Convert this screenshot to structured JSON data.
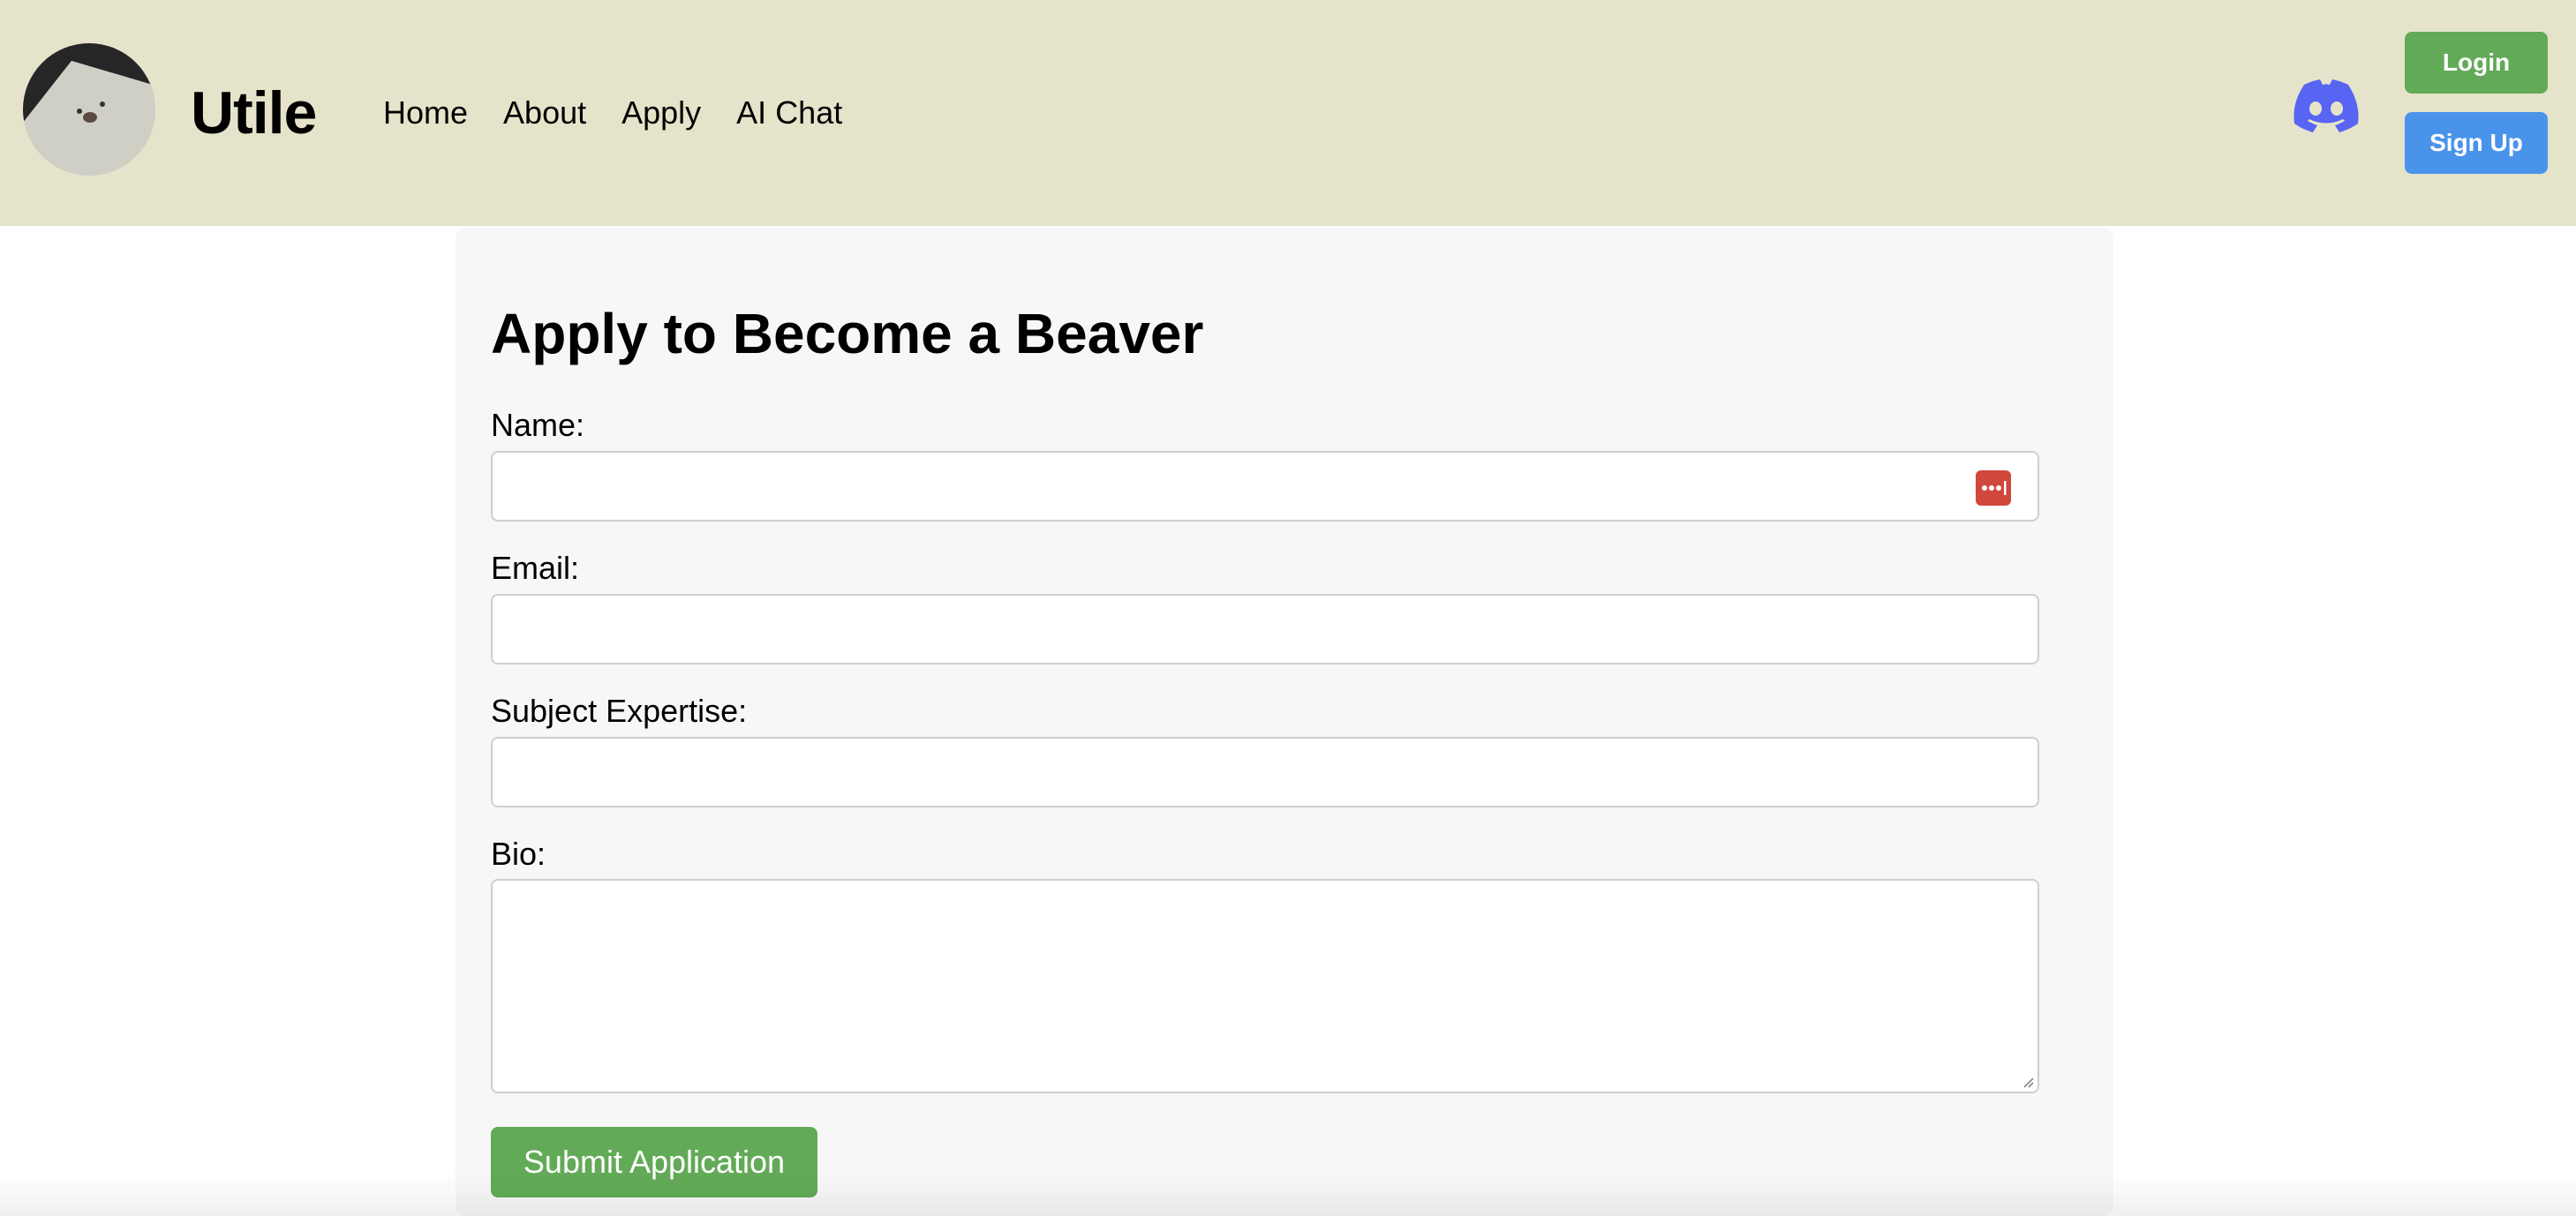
{
  "header": {
    "brand": "Utile",
    "nav": [
      "Home",
      "About",
      "Apply",
      "AI Chat"
    ],
    "login_label": "Login",
    "signup_label": "Sign Up"
  },
  "form": {
    "title": "Apply to Become a Beaver",
    "name_label": "Name:",
    "name_value": "",
    "email_label": "Email:",
    "email_value": "",
    "subject_label": "Subject Expertise:",
    "subject_value": "",
    "bio_label": "Bio:",
    "bio_value": "",
    "submit_label": "Submit Application"
  },
  "icons": {
    "logo": "beaver-avatar-logo",
    "discord": "discord-icon",
    "password_manager": "password-manager-icon",
    "resize": "resize-handle-icon"
  },
  "colors": {
    "header_bg": "#e5e4cb",
    "login_button": "#62aa57",
    "signup_button": "#4a93ea",
    "submit_button": "#62aa57",
    "discord": "#5865f2",
    "password_manager": "#d0473c"
  }
}
